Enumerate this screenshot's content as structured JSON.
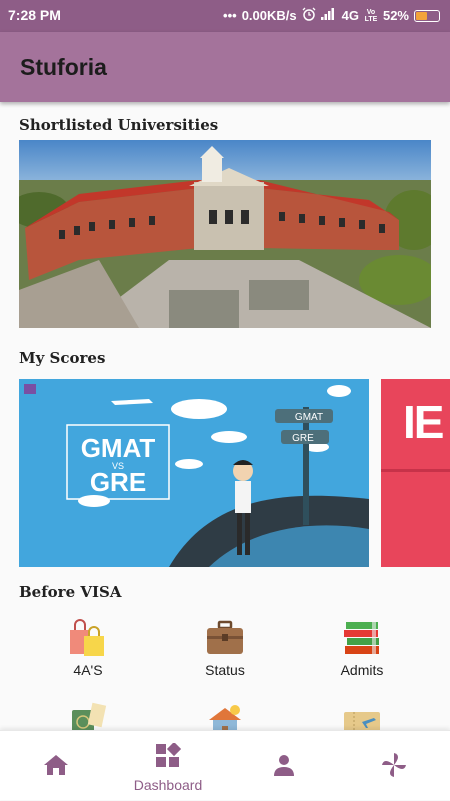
{
  "status_bar": {
    "time": "7:28 PM",
    "network_speed": "0.00KB/s",
    "network_type": "4G",
    "volte": "Vo LTE",
    "battery_percent": "52%",
    "battery_level": 0.52,
    "icons": [
      "dots-icon",
      "alarm-icon",
      "signal-icon",
      "battery-icon"
    ]
  },
  "app_bar": {
    "title": "Stuforia"
  },
  "sections": {
    "universities": {
      "title": "Shortlisted Universities"
    },
    "scores": {
      "title": "My Scores",
      "card1_text": {
        "main1": "GMAT",
        "vs": "VS",
        "main2": "GRE",
        "sign1": "GMAT",
        "sign2": "GRE"
      },
      "card2_text": "IE"
    },
    "visa": {
      "title": "Before VISA",
      "items": [
        {
          "label": "4A'S",
          "icon": "shopping-bags-icon"
        },
        {
          "label": "Status",
          "icon": "briefcase-icon"
        },
        {
          "label": "Admits",
          "icon": "books-icon"
        },
        {
          "label": "",
          "icon": "passport-icon"
        },
        {
          "label": "",
          "icon": "house-icon"
        },
        {
          "label": "",
          "icon": "ticket-icon"
        }
      ]
    }
  },
  "bottom_nav": {
    "items": [
      {
        "label": "",
        "icon": "home-icon"
      },
      {
        "label": "Dashboard",
        "icon": "dashboard-icon"
      },
      {
        "label": "",
        "icon": "profile-icon"
      },
      {
        "label": "",
        "icon": "pinwheel-icon"
      }
    ]
  },
  "colors": {
    "status_bar": "#8e5d87",
    "app_bar": "#a4739b",
    "accent": "#8e5d87"
  }
}
